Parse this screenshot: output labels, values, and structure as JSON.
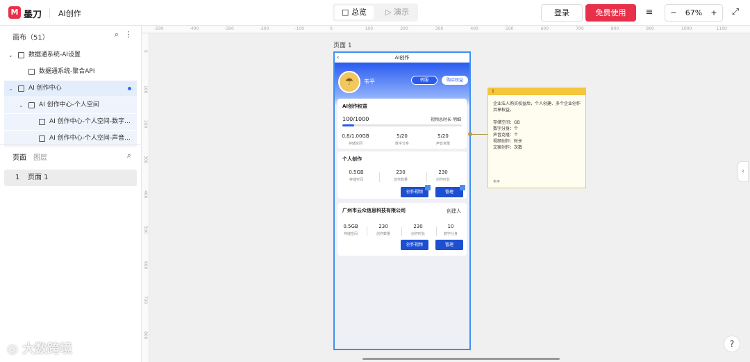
{
  "header": {
    "logo_glyph": "M",
    "app_name": "墨刀",
    "doc_title": "AI创作",
    "seg_overview": "总览",
    "seg_demo": "演示",
    "login_label": "登录",
    "free_label": "免费使用",
    "zoom_minus": "−",
    "zoom_value": "67%",
    "zoom_plus": "+",
    "icons": {
      "settings": "≡",
      "fullscreen": "⤢",
      "overview": "□",
      "demo": "▷"
    }
  },
  "sidebar": {
    "canvas_header": "画布（51）",
    "tree": [
      {
        "label": "数据通系统-AI设置",
        "indent": 0,
        "arrow": "⌄",
        "state": ""
      },
      {
        "label": "数据通系统-聚合API",
        "indent": 1,
        "arrow": "",
        "state": ""
      },
      {
        "label": "AI 创作中心",
        "indent": 0,
        "arrow": "⌄",
        "state": "sel"
      },
      {
        "label": "AI 创作中心-个人空间",
        "indent": 1,
        "arrow": "⌄",
        "state": "subsel"
      },
      {
        "label": "AI 创作中心-个人空间-数字...",
        "indent": 2,
        "arrow": "",
        "state": "subsel"
      },
      {
        "label": "AI 创作中心-个人空间-声音...",
        "indent": 2,
        "arrow": "",
        "state": "subsel"
      }
    ],
    "tab_pages": "页面",
    "tab_layers": "图层",
    "page_number": "1",
    "page_name": "页面 1"
  },
  "canvas": {
    "ruler_x": [
      "-500",
      "-400",
      "-300",
      "-200",
      "-100",
      "0",
      "100",
      "200",
      "300",
      "400",
      "500",
      "600",
      "700",
      "800",
      "900",
      "1000",
      "1100"
    ],
    "ruler_y": [
      "0",
      "100",
      "200",
      "300",
      "400",
      "500",
      "600",
      "700",
      "800"
    ],
    "frame_label": "页面 1",
    "collapse_glyph": "‹",
    "help_glyph": "?",
    "watermark": "大数跨境"
  },
  "phone": {
    "back_glyph": "‹",
    "title": "AI创作",
    "user_name": "韦平",
    "avatar_glyph": "☂",
    "btn_renew": "转服",
    "btn_buy": "购买权益",
    "rights": {
      "title": "AI创作权益",
      "right_label1": "视频总时长",
      "right_label2": "明细",
      "usage": "100/1000",
      "progress": 0.1,
      "stats": [
        {
          "value": "0.8/1.00GB",
          "label": "存储空间"
        },
        {
          "value": "5/20",
          "label": "数字分身"
        },
        {
          "value": "5/20",
          "label": "声音克隆"
        }
      ]
    },
    "personal": {
      "title": "个人创作",
      "stats": [
        {
          "value": "0.5GB",
          "label": "存储空间"
        },
        {
          "value": "230",
          "label": "创作数量"
        },
        {
          "value": "230",
          "label": "创作时长"
        }
      ],
      "btn_create": "创作视频",
      "btn_manage": "管理"
    },
    "company": {
      "title": "广州市云众信息科技有限公司",
      "role": "创建人",
      "stats": [
        {
          "value": "0.5GB",
          "label": "存储空间"
        },
        {
          "value": "230",
          "label": "创作数量"
        },
        {
          "value": "230",
          "label": "创作时长"
        },
        {
          "value": "10",
          "label": "数字分身"
        }
      ],
      "btn_create": "创作视频",
      "btn_manage": "管理"
    }
  },
  "note": {
    "number": "1",
    "body": "企业法人购买权益后，个人创建、多个企业创作共享权益。\n\n存储空间：GB\n数字分身：个\n声音克隆：个\n视频创作：时长\n文案创作：次数",
    "author": "韦平"
  },
  "colors": {
    "accent": "#2a5bf0",
    "brand": "#e8304a",
    "note": "#f5c53c",
    "frame": "#3d8ff5"
  }
}
